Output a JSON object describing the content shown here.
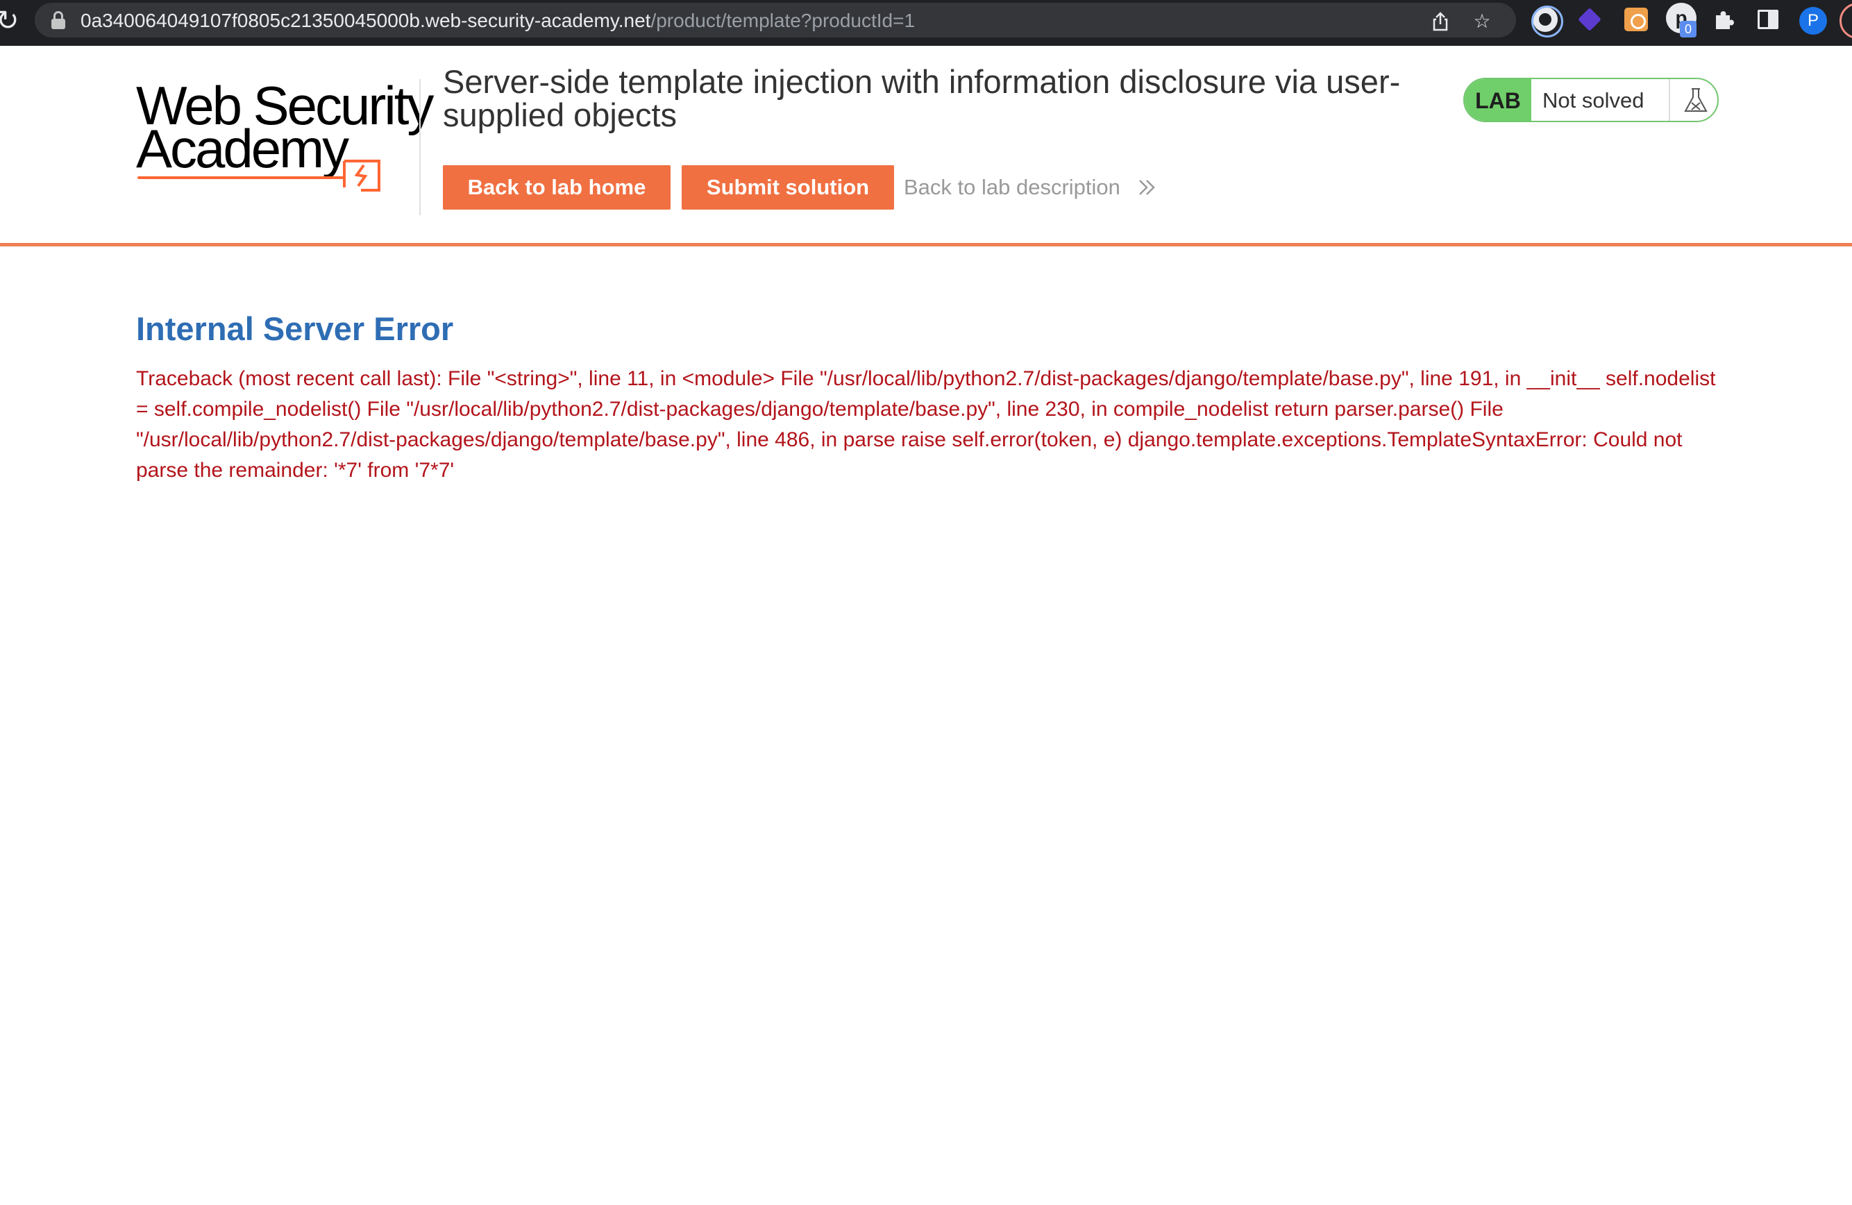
{
  "browser": {
    "url_host": "0a340064049107f0805c21350045000b.web-security-academy.net",
    "url_path": "/product/template?productId=1",
    "extension_badge": "0",
    "profile_initial": "P",
    "p_extension_letter": "p"
  },
  "header": {
    "logo_line1": "Web Security",
    "logo_line2": "Academy",
    "lab_title": "Server-side template injection with information disclosure via user-supplied objects",
    "back_home_label": "Back to lab home",
    "submit_label": "Submit solution",
    "description_link": "Back to lab description",
    "status_badge": {
      "tag": "LAB",
      "status": "Not solved"
    }
  },
  "colors": {
    "accent": "#f07042",
    "error_title": "#2e6db4",
    "error_text": "#b3141b",
    "lab_green": "#70cf6b"
  },
  "content": {
    "error_title": "Internal Server Error",
    "traceback": " Traceback (most recent call last): File \"<string>\", line 11, in <module> File \"/usr/local/lib/python2.7/dist-packages/django/template/base.py\", line 191, in __init__ self.nodelist = self.compile_nodelist() File \"/usr/local/lib/python2.7/dist-packages/django/template/base.py\", line 230, in compile_nodelist return parser.parse() File \"/usr/local/lib/python2.7/dist-packages/django/template/base.py\", line 486, in parse raise self.error(token, e) django.template.exceptions.TemplateSyntaxError: Could not parse the remainder: '*7' from '7*7'"
  }
}
